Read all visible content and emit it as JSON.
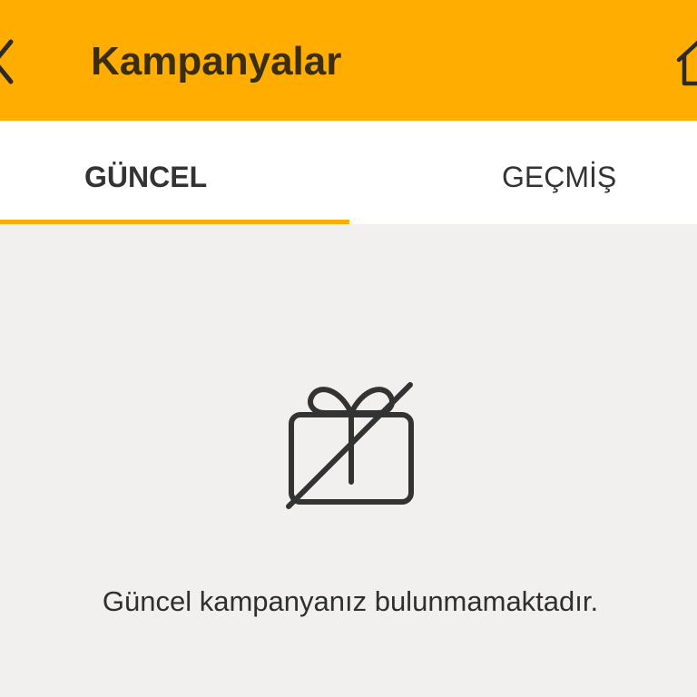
{
  "header": {
    "title": "Kampanyalar",
    "back_icon": "chevron-left-icon",
    "home_icon": "home-icon",
    "background_color": "#ffad00"
  },
  "tabs": [
    {
      "label": "GÜNCEL",
      "active": true
    },
    {
      "label": "GEÇMİŞ",
      "active": false
    }
  ],
  "empty_state": {
    "icon": "no-gift-icon",
    "message": "Güncel kampanyanız bulunmamaktadır."
  }
}
